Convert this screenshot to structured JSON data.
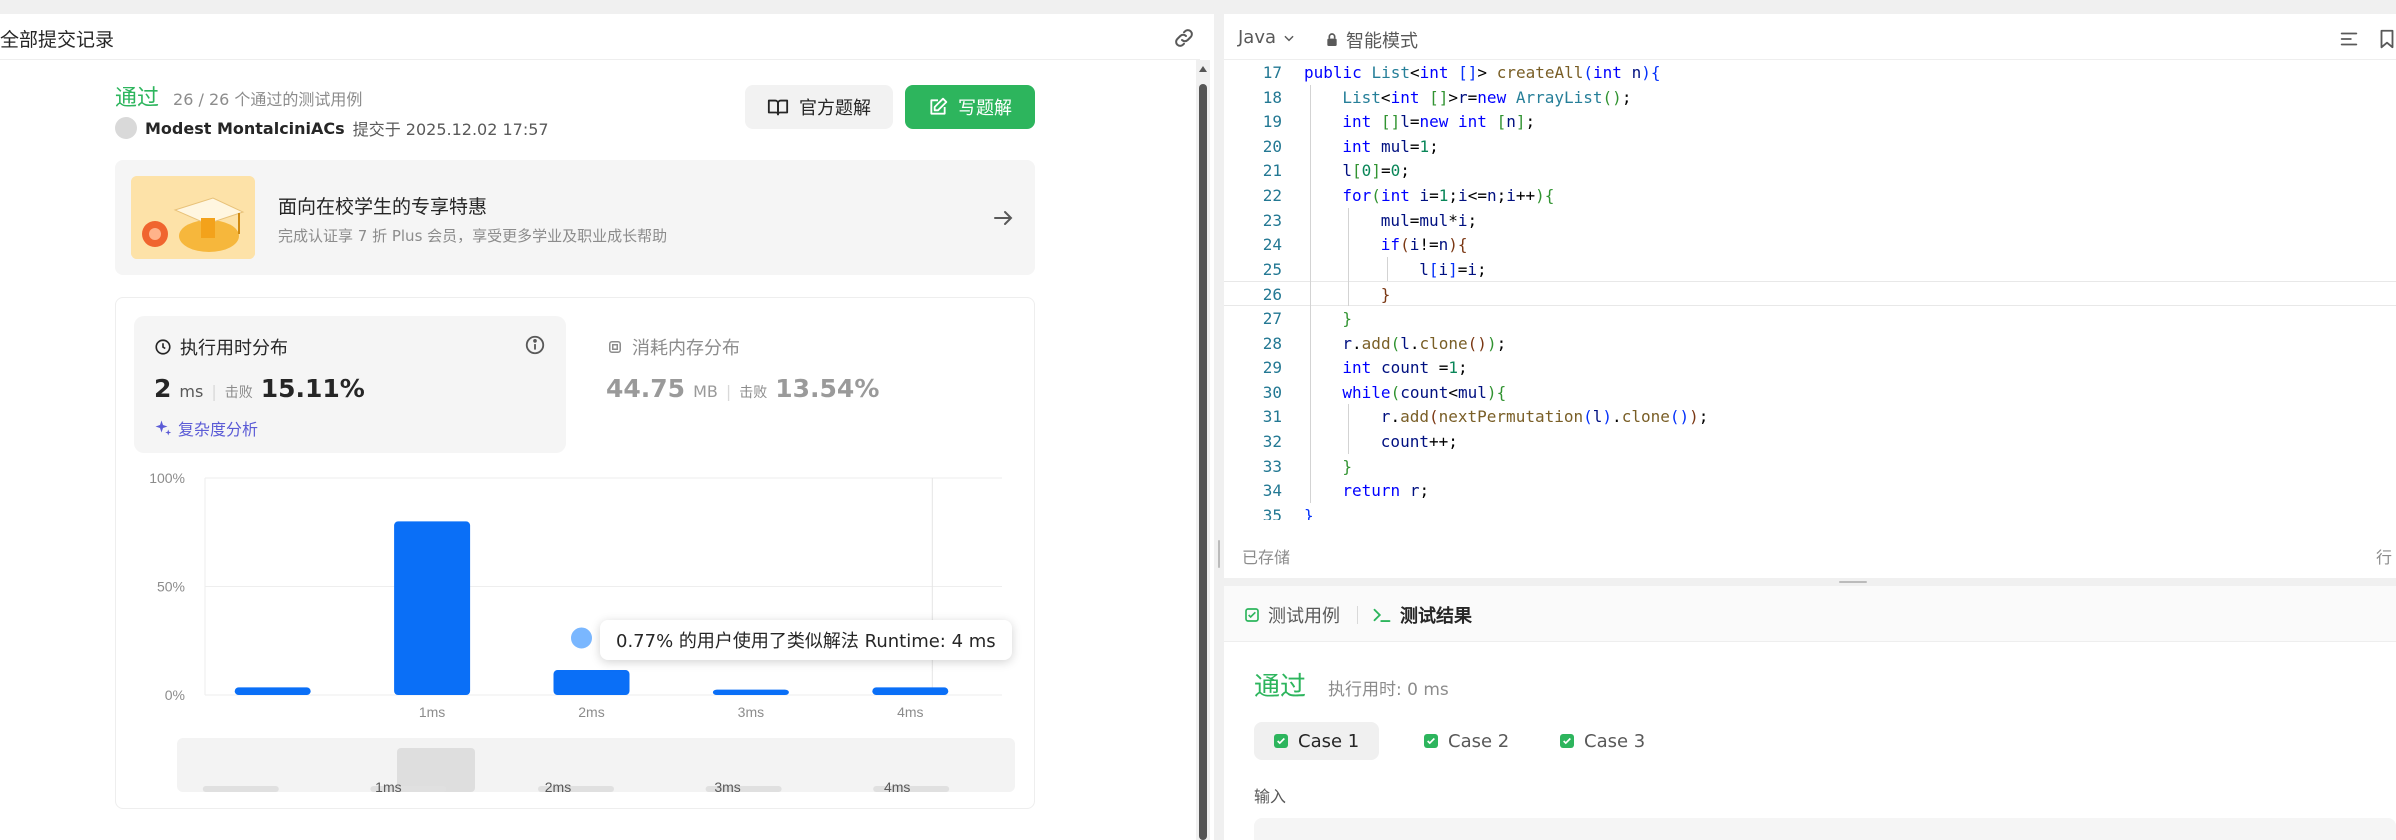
{
  "left": {
    "header_title": "全部提交记录",
    "status": "通过",
    "test_count": "26 / 26 个通过的测试用例",
    "author": "Modest MontalciniACs",
    "submit_time": "提交于 2025.12.02 17:57",
    "official_solution": "官方题解",
    "write_solution": "写题解",
    "promo_title": "面向在校学生的专享特惠",
    "promo_sub": "完成认证享 7 折 Plus 会员，享受更多学业及职业成长帮助",
    "runtime_title": "执行用时分布",
    "runtime_value": "2",
    "runtime_unit": "ms",
    "beat_label": "击败",
    "runtime_beat": "15.11%",
    "complexity": "复杂度分析",
    "memory_title": "消耗内存分布",
    "memory_value": "44.75",
    "memory_unit": "MB",
    "memory_beat": "13.54%",
    "tooltip": "0.77% 的用户使用了类似解法 Runtime: 4 ms"
  },
  "chart_data": {
    "type": "bar",
    "categories": [
      "",
      "1ms",
      "2ms",
      "3ms",
      "4ms"
    ],
    "values": [
      3.5,
      80,
      11.5,
      2.5,
      3.5
    ],
    "highlight_index": 2,
    "yticks": [
      "100%",
      "50%",
      "0%"
    ],
    "ylim": [
      0,
      100
    ],
    "mini_labels": [
      "1ms",
      "2ms",
      "3ms",
      "4ms"
    ],
    "mini_values": [
      9,
      100,
      20,
      20,
      20,
      20
    ],
    "bar_color": "#0a6ff7",
    "grid": true
  },
  "editor": {
    "language": "Java",
    "mode": "智能模式",
    "saved": "已存储",
    "row_label": "行",
    "lines": [
      {
        "n": "17",
        "indent": 1,
        "html": "<span class='kw'>public</span> <span class='ty'>List</span>&lt;<span class='kw'>int</span> <span class='br1'>[]</span>&gt; <span class='fn'>createAll</span><span class='br1'>(</span><span class='kw'>int</span> <span class='va'>n</span><span class='br1'>)</span><span class='br1'>{</span>"
      },
      {
        "n": "18",
        "indent": 2,
        "html": "<span class='ty'>List</span>&lt;<span class='kw'>int</span> <span class='br2'>[]</span>&gt;<span class='va'>r</span>=<span class='kw'>new</span> <span class='ty'>ArrayList</span><span class='br2'>()</span>;"
      },
      {
        "n": "19",
        "indent": 2,
        "html": "<span class='kw'>int</span> <span class='br2'>[]</span><span class='va'>l</span>=<span class='kw'>new</span> <span class='kw'>int</span> <span class='br2'>[</span><span class='va'>n</span><span class='br2'>]</span>;"
      },
      {
        "n": "20",
        "indent": 2,
        "html": "<span class='kw'>int</span> <span class='va'>mul</span>=<span class='nu'>1</span>;"
      },
      {
        "n": "21",
        "indent": 2,
        "html": "<span class='va'>l</span><span class='br2'>[</span><span class='nu'>0</span><span class='br2'>]</span>=<span class='nu'>0</span>;"
      },
      {
        "n": "22",
        "indent": 2,
        "html": "<span class='kw'>for</span><span class='br2'>(</span><span class='kw'>int</span> <span class='va'>i</span>=<span class='nu'>1</span>;<span class='va'>i</span>&lt;=<span class='va'>n</span>;<span class='va'>i</span>++<span class='br2'>)</span><span class='br2'>{</span>"
      },
      {
        "n": "23",
        "indent": 3,
        "html": "<span class='va'>mul</span>=<span class='va'>mul</span>*<span class='va'>i</span>;"
      },
      {
        "n": "24",
        "indent": 3,
        "html": "<span class='kw'>if</span><span class='br3'>(</span><span class='va'>i</span>!=<span class='va'>n</span><span class='br3'>)</span><span class='br3'>{</span>"
      },
      {
        "n": "25",
        "indent": 4,
        "html": "<span class='va'>l</span><span class='br1'>[</span><span class='va'>i</span><span class='br1'>]</span>=<span class='va'>i</span>;"
      },
      {
        "n": "26",
        "indent": 3,
        "html": "<span class='br3'>}</span>",
        "current": true
      },
      {
        "n": "27",
        "indent": 2,
        "html": "<span class='br2'>}</span>"
      },
      {
        "n": "28",
        "indent": 2,
        "html": "<span class='va'>r</span>.<span class='fn'>add</span><span class='br2'>(</span><span class='va'>l</span>.<span class='fn'>clone</span><span class='br3'>()</span><span class='br2'>)</span>;"
      },
      {
        "n": "29",
        "indent": 2,
        "html": "<span class='kw'>int</span> <span class='va'>count</span> =<span class='nu'>1</span>;"
      },
      {
        "n": "30",
        "indent": 2,
        "html": "<span class='kw'>while</span><span class='br2'>(</span><span class='va'>count</span>&lt;<span class='va'>mul</span><span class='br2'>)</span><span class='br2'>{</span>"
      },
      {
        "n": "31",
        "indent": 3,
        "html": "<span class='va'>r</span>.<span class='fn'>add</span><span class='br3'>(</span><span class='fn'>nextPermutation</span><span class='br1'>(</span><span class='va'>l</span><span class='br1'>)</span>.<span class='fn'>clone</span><span class='br1'>()</span><span class='br3'>)</span>;"
      },
      {
        "n": "32",
        "indent": 3,
        "html": "<span class='va'>count</span>++;"
      },
      {
        "n": "33",
        "indent": 2,
        "html": "<span class='br2'>}</span>"
      },
      {
        "n": "34",
        "indent": 2,
        "html": "<span class='kw'>return</span> <span class='va'>r</span>;"
      },
      {
        "n": "35",
        "indent": 1,
        "html": "<span class='br1'>}</span>"
      }
    ]
  },
  "test": {
    "tab_testcase": "测试用例",
    "tab_result": "测试结果",
    "status": "通过",
    "runtime": "执行用时: 0 ms",
    "cases": [
      "Case 1",
      "Case 2",
      "Case 3"
    ],
    "input_label": "输入"
  },
  "colors": {
    "accent_green": "#2db55d",
    "bar_blue": "#0a6ff7",
    "purple": "#5b5bd6"
  }
}
